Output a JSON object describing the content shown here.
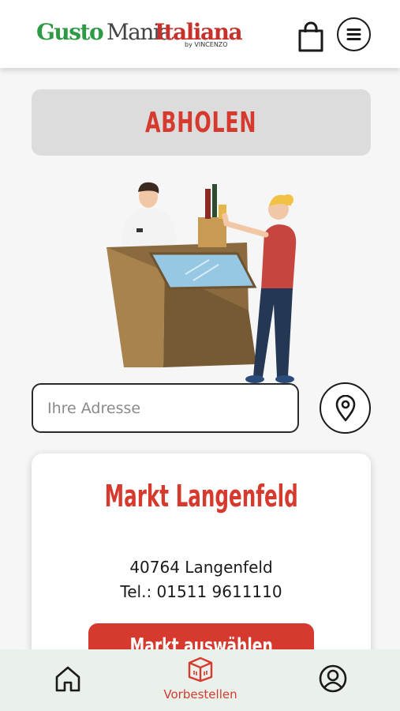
{
  "header": {
    "logo": {
      "part1": "GustoMania",
      "part2": "Mania",
      "part3": "Italiana",
      "byline": "by Vincenzo",
      "alt": "GustoManiaItaliana by Vincenzo"
    },
    "cart_icon": "shopping-bag-icon",
    "menu_icon": "hamburger-menu-icon"
  },
  "mode": {
    "label": "ABHOLEN"
  },
  "address": {
    "placeholder": "Ihre Adresse",
    "value": "",
    "location_icon": "map-pin-icon"
  },
  "store": {
    "name": "Markt Langenfeld",
    "city": "40764 Langenfeld",
    "phone": "Tel.: 01511 9611110",
    "select_label": "Markt auswählen"
  },
  "bottom_nav": {
    "items": [
      {
        "icon": "home-icon",
        "label": ""
      },
      {
        "icon": "package-icon",
        "label": "Vorbestellen",
        "active": true
      },
      {
        "icon": "user-circle-icon",
        "label": ""
      }
    ]
  },
  "colors": {
    "accent": "#d63a2e",
    "logo_green": "#2f9a45",
    "nav_bg": "#eaf0ea"
  }
}
